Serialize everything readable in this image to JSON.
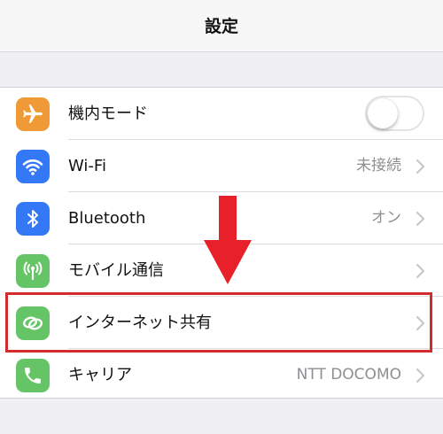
{
  "navbar": {
    "title": "設定"
  },
  "settings": {
    "items": [
      {
        "label": "機内モード",
        "value": "",
        "icon": "airplane-icon",
        "color": "#f09a37",
        "control": "toggle",
        "toggle_on": false
      },
      {
        "label": "Wi-Fi",
        "value": "未接続",
        "icon": "wifi-icon",
        "color": "#3478f6",
        "control": "chevron"
      },
      {
        "label": "Bluetooth",
        "value": "オン",
        "icon": "bluetooth-icon",
        "color": "#3478f6",
        "control": "chevron"
      },
      {
        "label": "モバイル通信",
        "value": "",
        "icon": "cellular-antenna-icon",
        "color": "#65c466",
        "control": "chevron"
      },
      {
        "label": "インターネット共有",
        "value": "",
        "icon": "personal-hotspot-icon",
        "color": "#65c466",
        "control": "chevron"
      },
      {
        "label": "キャリア",
        "value": "NTT DOCOMO",
        "icon": "phone-icon",
        "color": "#65c466",
        "control": "chevron"
      }
    ]
  },
  "annotation": {
    "highlight_color": "#d32a2e",
    "arrow_color": "#e8202a",
    "target_item": "インターネット共有"
  }
}
